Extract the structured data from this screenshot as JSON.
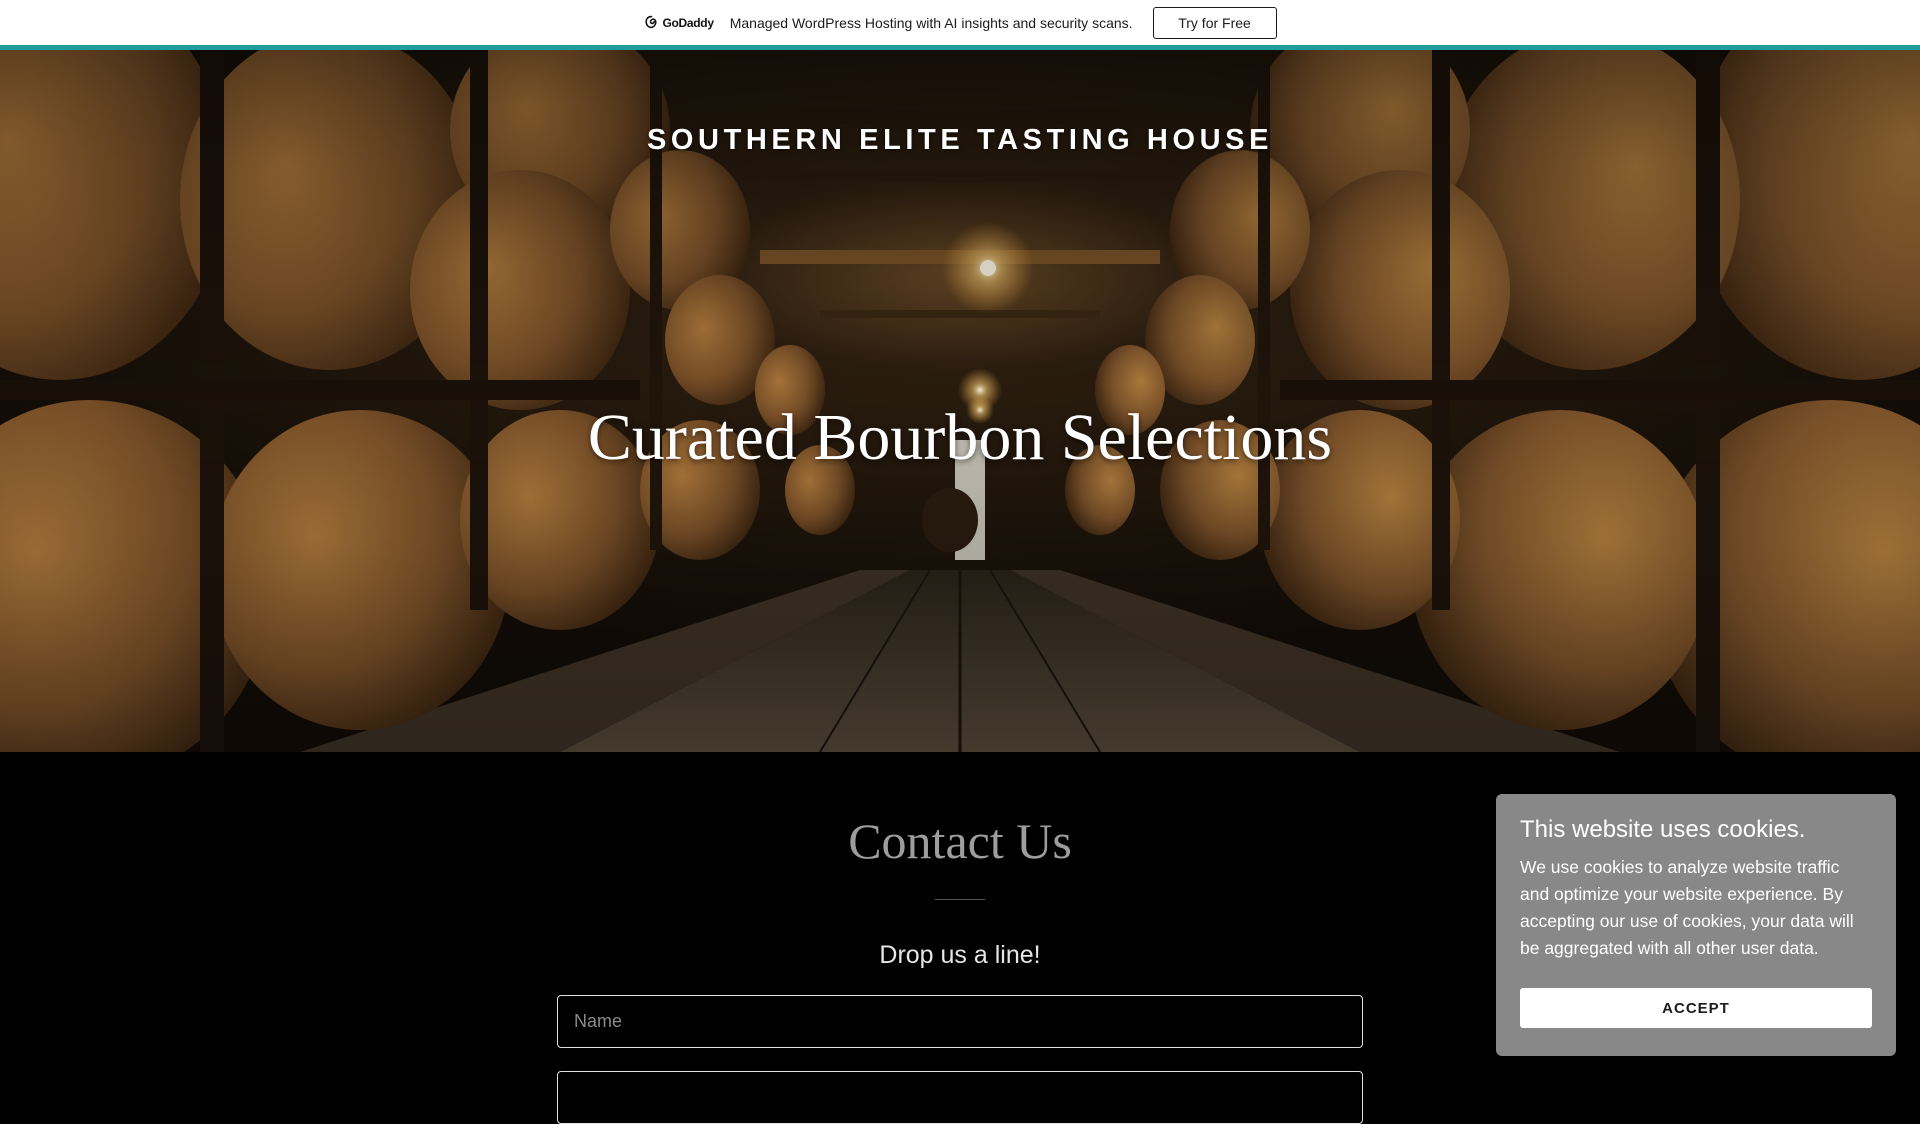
{
  "promo": {
    "brand": "GoDaddy",
    "text": "Managed WordPress Hosting with AI insights and security scans.",
    "button_label": "Try for Free",
    "accent_color": "#1f9d9d"
  },
  "hero": {
    "site_title": "SOUTHERN ELITE TASTING HOUSE",
    "heading": "Curated Bourbon Selections"
  },
  "contact": {
    "title": "Contact Us",
    "subtitle": "Drop us a line!",
    "name_placeholder": "Name",
    "email_placeholder": ""
  },
  "cookie_banner": {
    "title": "This website uses cookies.",
    "body": "We use cookies to analyze website traffic and optimize your website experience. By accepting our use of cookies, your data will be aggregated with all other user data.",
    "accept_label": "ACCEPT"
  }
}
